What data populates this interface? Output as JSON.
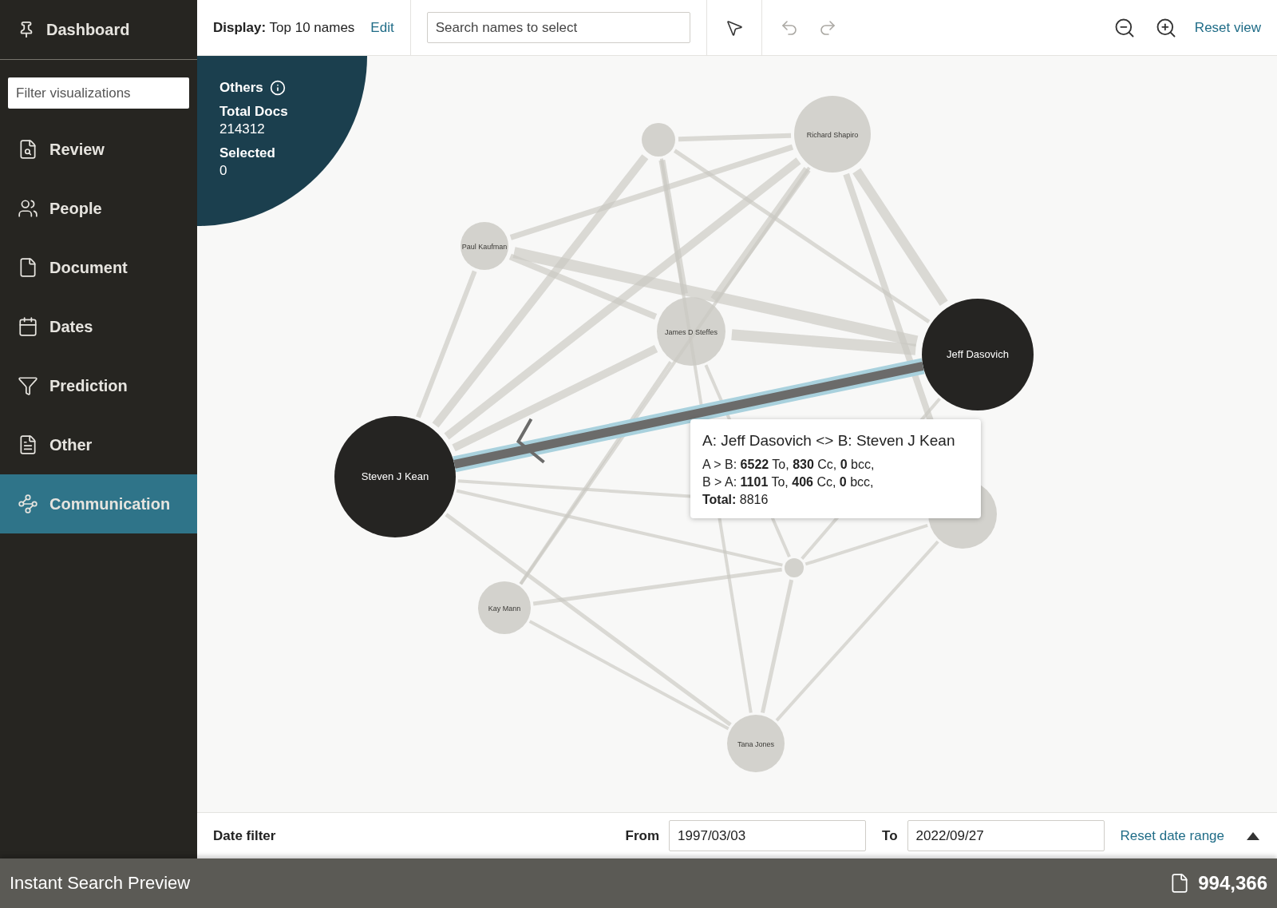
{
  "sidebar": {
    "header": "Dashboard",
    "filter": {
      "placeholder": "Filter visualizations"
    },
    "items": [
      {
        "label": "Review",
        "selected": false
      },
      {
        "label": "People",
        "selected": false
      },
      {
        "label": "Document",
        "selected": false
      },
      {
        "label": "Dates",
        "selected": false
      },
      {
        "label": "Prediction",
        "selected": false
      },
      {
        "label": "Other",
        "selected": false
      },
      {
        "label": "Communication",
        "selected": true
      }
    ]
  },
  "toolbar": {
    "display_label": "Display:",
    "display_value": "Top 10 names",
    "edit": "Edit",
    "search": {
      "placeholder": "Search names to select"
    },
    "undo": {
      "disabled": true
    },
    "redo": {
      "disabled": true
    },
    "reset_view": "Reset view"
  },
  "summary": {
    "title": "Others",
    "total_docs_label": "Total Docs",
    "total_docs": "214312",
    "selected_label": "Selected",
    "selected": "0"
  },
  "graph": {
    "nodes": [
      {
        "selected": false
      },
      {
        "label": "Richard Shapiro",
        "selected": false
      },
      {
        "label": "Paul Kaufman",
        "selected": false
      },
      {
        "label": "James D Steffes",
        "selected": false
      },
      {
        "label": "Jeff Dasovich",
        "selected": true
      },
      {
        "label": "Steven J Kean",
        "selected": true
      },
      {
        "selected": false
      },
      {
        "selected": false
      },
      {
        "label": "Kay Mann",
        "selected": false
      },
      {
        "label": "Tana Jones",
        "selected": false
      }
    ]
  },
  "tooltip": {
    "title": "A: Jeff Dasovich <> B: Steven J Kean",
    "lines": [
      "A > B: **6522** To, **830** Cc, **0** bcc,",
      "B > A: **1101** To, **406** Cc, **0** bcc,",
      "**Total:** 8816"
    ]
  },
  "date_filter": {
    "label": "Date filter",
    "from_label": "From",
    "from": "1997/03/03",
    "to_label": "To",
    "to": "2022/09/27",
    "reset": "Reset date range"
  },
  "footer": {
    "title": "Instant Search Preview",
    "count": "994,366"
  }
}
